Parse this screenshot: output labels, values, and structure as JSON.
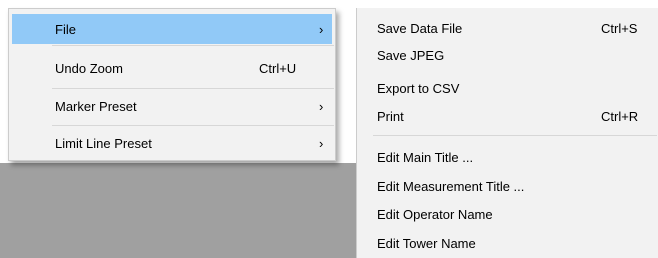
{
  "main_menu": {
    "items": [
      {
        "label": "File",
        "shortcut": "",
        "submenu_arrow": "›"
      },
      {
        "label": "Undo Zoom",
        "shortcut": "Ctrl+U",
        "submenu_arrow": ""
      },
      {
        "label": "Marker Preset",
        "shortcut": "",
        "submenu_arrow": "›"
      },
      {
        "label": "Limit Line Preset",
        "shortcut": "",
        "submenu_arrow": "›"
      }
    ],
    "highlight_color": "#91c9f7"
  },
  "file_submenu": {
    "items": [
      {
        "label": "Save Data File",
        "shortcut": "Ctrl+S"
      },
      {
        "label": "Save JPEG",
        "shortcut": ""
      },
      {
        "label": "Export to CSV",
        "shortcut": ""
      },
      {
        "label": "Print",
        "shortcut": "Ctrl+R"
      },
      {
        "label": "Edit Main Title ...",
        "shortcut": ""
      },
      {
        "label": "Edit Measurement Title ...",
        "shortcut": ""
      },
      {
        "label": "Edit Operator Name",
        "shortcut": ""
      },
      {
        "label": "Edit Tower Name",
        "shortcut": ""
      }
    ]
  }
}
